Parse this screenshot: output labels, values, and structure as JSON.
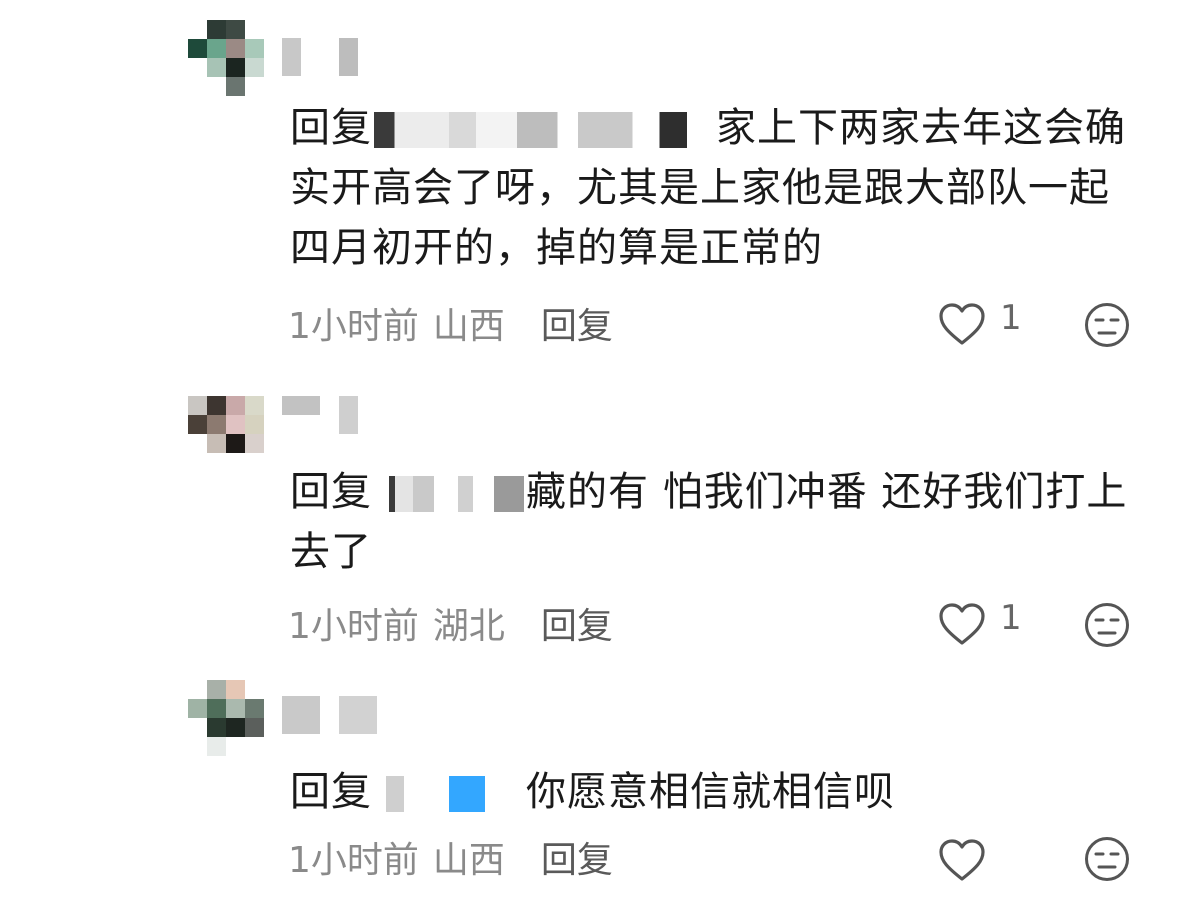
{
  "comments": [
    {
      "reply_prefix": "回复",
      "text_after_mention": "家上下两家去年这会确实开高会了呀，尤其是上家他是跟大部队一起四月初开的，掉的算是正常的",
      "time": "1小时前",
      "location": "山西",
      "reply_label": "回复",
      "likes": "1"
    },
    {
      "reply_prefix": "回复",
      "text_after_mention": "藏的有 怕我们冲番 还好我们打上去了",
      "time": "1小时前",
      "location": "湖北",
      "reply_label": "回复",
      "likes": "1"
    },
    {
      "reply_prefix": "回复",
      "text_after_mention": "你愿意相信就相信呗",
      "time": "1小时前",
      "location": "山西",
      "reply_label": "回复",
      "likes": ""
    }
  ],
  "icons": {
    "like": "heart-outline-icon",
    "dislike": "unamused-face-icon"
  },
  "colors": {
    "text": "#1a1a1a",
    "meta": "#8a8a8a",
    "icon": "#555555"
  }
}
